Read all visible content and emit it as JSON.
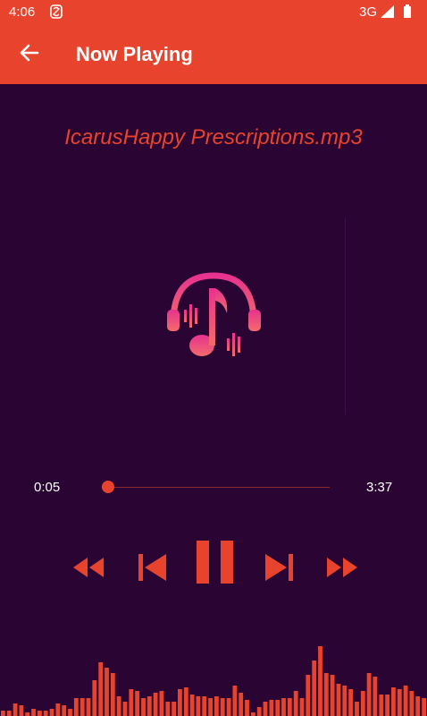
{
  "status_bar": {
    "time": "4:06",
    "network": "3G",
    "icons": [
      "notification-icon",
      "signal-icon",
      "battery-icon"
    ]
  },
  "app_bar": {
    "title": "Now Playing",
    "back_icon": "arrow-back-icon",
    "color": "#e8432c"
  },
  "player": {
    "song_title": "IcarusHappy Prescriptions.mp3",
    "current_time": "0:05",
    "total_time": "3:37",
    "progress": 0.02,
    "state": "playing",
    "controls": [
      "fast-rewind",
      "skip-previous",
      "pause",
      "skip-next",
      "fast-forward"
    ]
  },
  "visualizer": {
    "color": "#e8432c",
    "levels": [
      0.06,
      0.06,
      0.14,
      0.12,
      0.04,
      0.08,
      0.06,
      0.06,
      0.08,
      0.14,
      0.12,
      0.08,
      0.2,
      0.2,
      0.2,
      0.4,
      0.6,
      0.54,
      0.48,
      0.22,
      0.16,
      0.3,
      0.28,
      0.2,
      0.22,
      0.26,
      0.28,
      0.16,
      0.16,
      0.3,
      0.32,
      0.24,
      0.22,
      0.22,
      0.2,
      0.22,
      0.2,
      0.2,
      0.34,
      0.26,
      0.18,
      0.04,
      0.1,
      0.16,
      0.18,
      0.18,
      0.2,
      0.2,
      0.28,
      0.2,
      0.46,
      0.62,
      0.78,
      0.48,
      0.46,
      0.36,
      0.34,
      0.3,
      0.16,
      0.28,
      0.48,
      0.44,
      0.24,
      0.24,
      0.32,
      0.3,
      0.34,
      0.28,
      0.22,
      0.2
    ]
  },
  "colors": {
    "accent": "#e8432c",
    "background": "#2a0433",
    "art_gradient_start": "#e8328f",
    "art_gradient_end": "#f05a7a"
  }
}
